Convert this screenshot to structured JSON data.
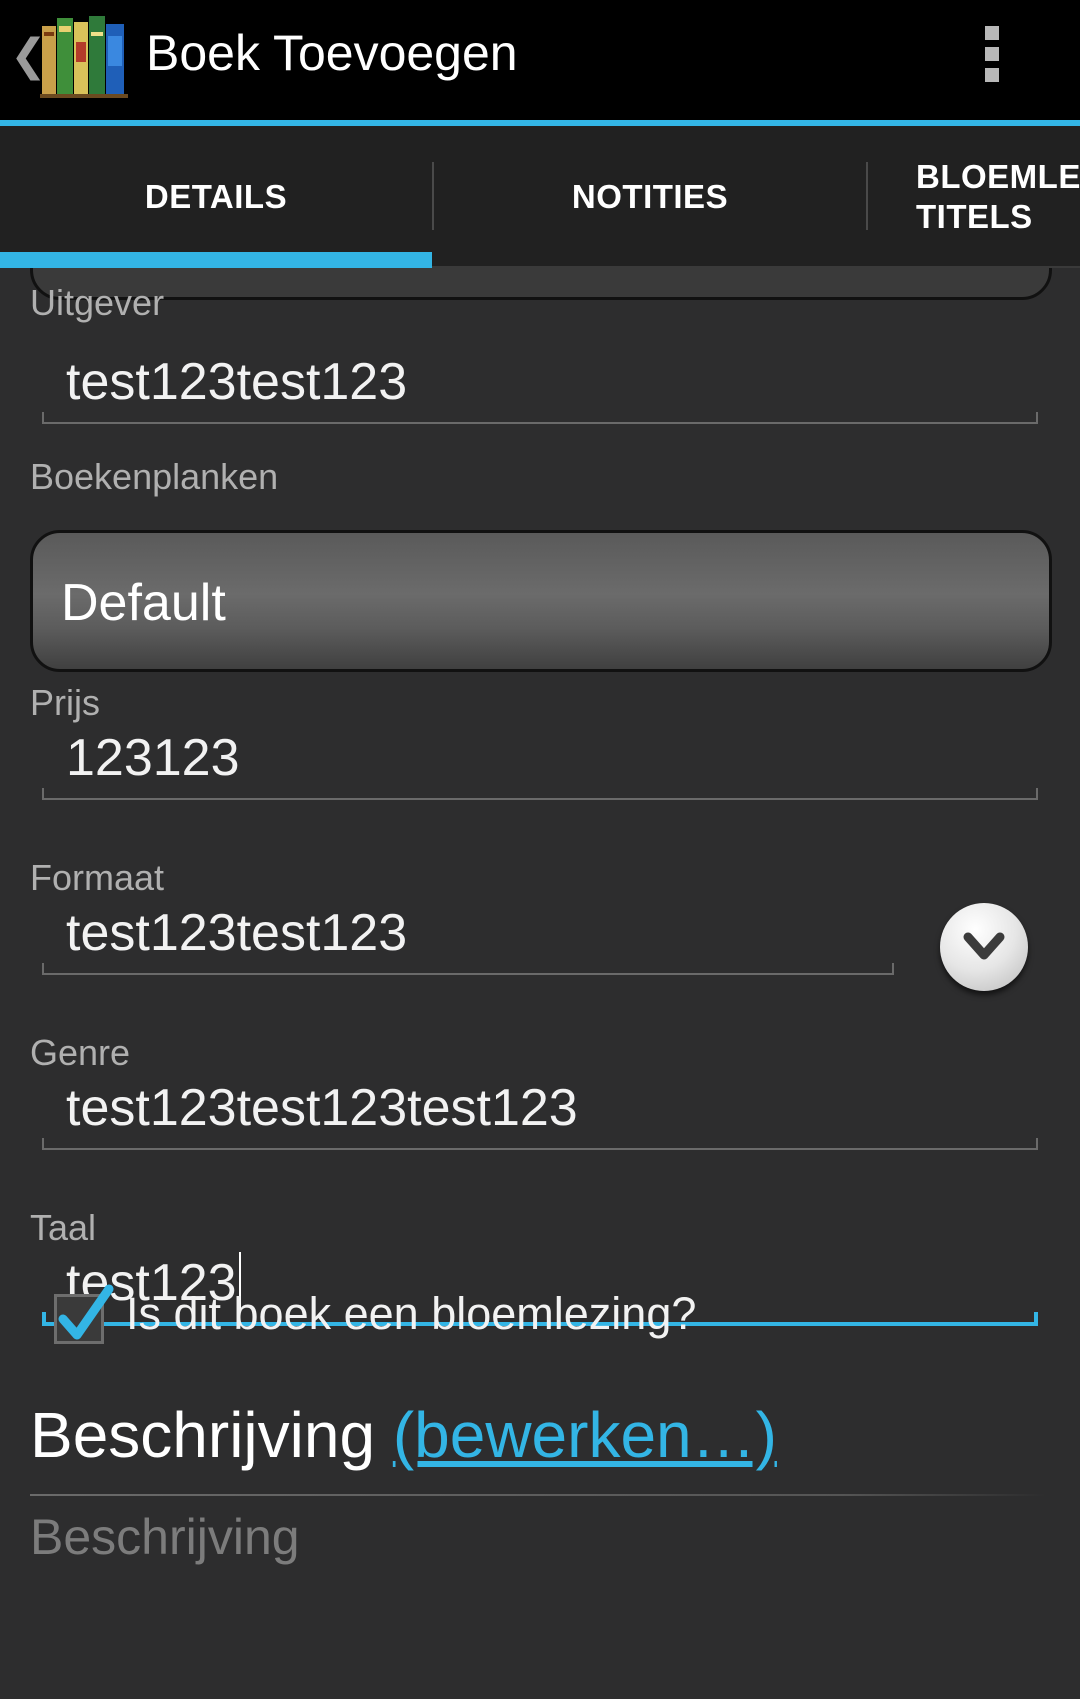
{
  "app": {
    "title": "Boek Toevoegen",
    "up_caret": "❮"
  },
  "tabs": [
    {
      "label": "DETAILS",
      "selected": true
    },
    {
      "label": "NOTITIES",
      "selected": false
    },
    {
      "label": "BLOEMLEZ\nTITELS",
      "selected": false
    }
  ],
  "fields": {
    "publisher": {
      "label": "Uitgever",
      "value": "test123test123"
    },
    "bookshelves": {
      "label": "Boekenplanken",
      "value": "Default"
    },
    "price": {
      "label": "Prijs",
      "value": "123123"
    },
    "format": {
      "label": "Formaat",
      "value": "test123test123"
    },
    "genre": {
      "label": "Genre",
      "value": "test123test123test123"
    },
    "language": {
      "label": "Taal",
      "value": "test123"
    }
  },
  "anthology": {
    "label": "Is dit boek een bloemlezing?",
    "checked": true
  },
  "description": {
    "title": "Beschrijving",
    "edit_link": "(bewerken…)",
    "placeholder": "Beschrijving"
  },
  "colors": {
    "accent": "#33b5e5",
    "background": "#2d2d2e"
  }
}
